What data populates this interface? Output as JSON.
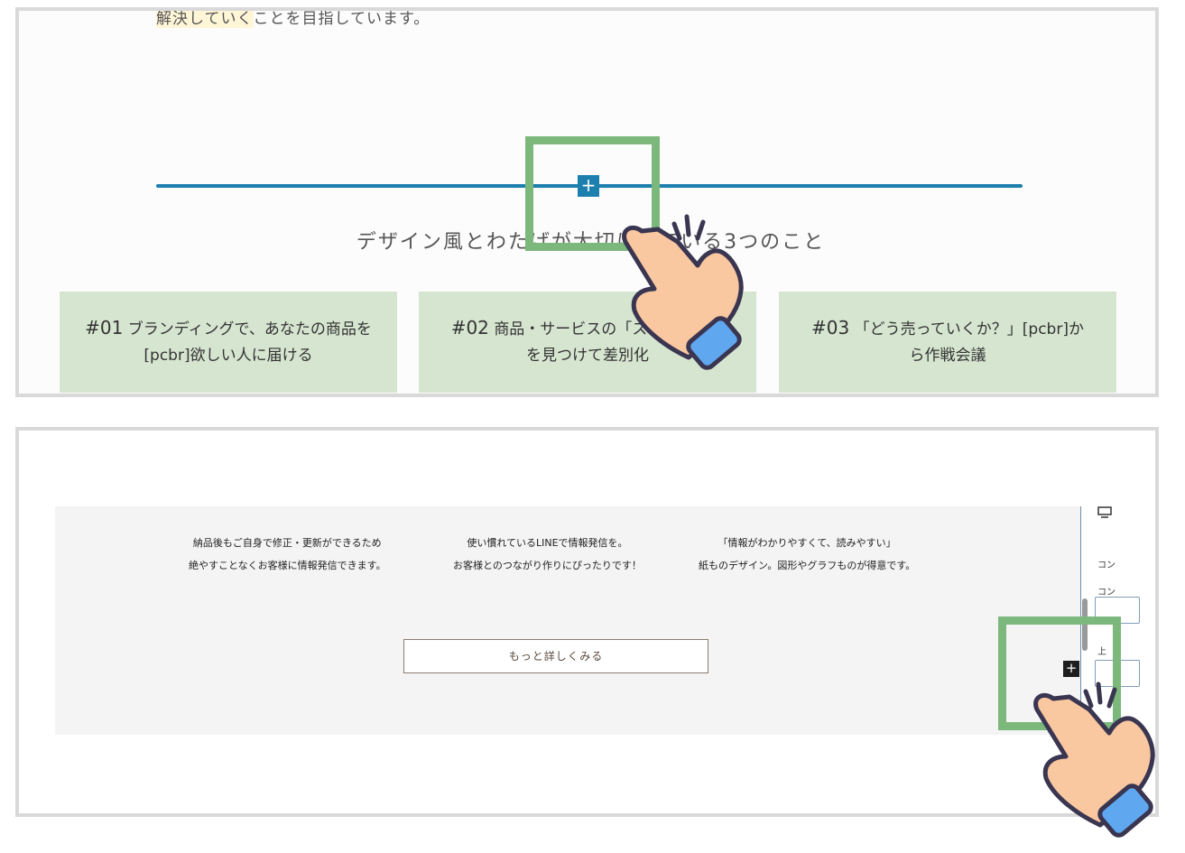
{
  "top_panel": {
    "intro_highlight": "解決していく",
    "intro_rest": "ことを目指しています。",
    "add_block_symbol": "+",
    "section_title": "デザイン風とわたげが大切にしている3つのこと",
    "cards": [
      {
        "num": "#01",
        "text": "ブランディングで、あなたの商品を[pcbr]欲しい人に届ける"
      },
      {
        "num": "#02",
        "text": "商品・サービスの「ストーリー」を見つけて差別化"
      },
      {
        "num": "#03",
        "text": "「どう売っていくか？」[pcbr]から作戦会議"
      }
    ]
  },
  "bottom_panel": {
    "features": [
      {
        "line1": "納品後もご自身で修正・更新ができるため",
        "line2": "絶やすことなくお客様に情報発信できます。"
      },
      {
        "line1": "使い慣れているLINEで情報発信を。",
        "line2": "お客様とのつながり作りにぴったりです！"
      },
      {
        "line1": "「情報がわかりやすくて、読みやすい」",
        "line2": "紙ものデザイン。図形やグラフものが得意です。"
      }
    ],
    "more_button": "もっと詳しくみる",
    "add_block_symbol": "+",
    "sidebar": {
      "label1": "コン",
      "label2": "コン",
      "label3": "上"
    }
  },
  "colors": {
    "accent_blue": "#1c7fae",
    "card_green": "#d6e5d0",
    "highlight_green": "#7cb87c",
    "hand_skin": "#f9c7a0",
    "hand_sleeve": "#5fa8f0"
  },
  "icons": {
    "pointer": "tap-hand-icon",
    "device": "desktop-icon"
  }
}
